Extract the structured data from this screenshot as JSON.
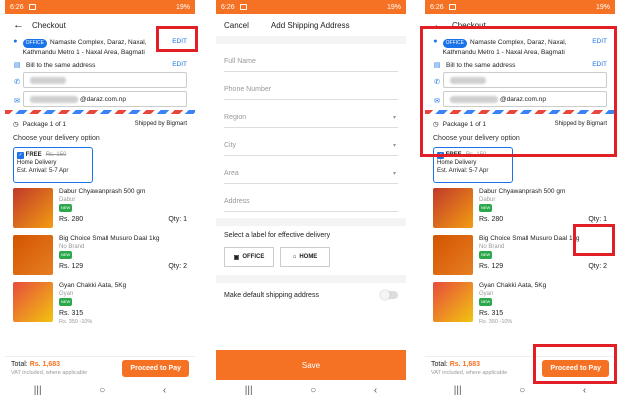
{
  "status": {
    "time": "6:26",
    "battery": "19%"
  },
  "checkout": {
    "title": "Checkout",
    "edit": "EDIT",
    "tag": "OFFICE",
    "address": "Namaste Complex, Daraz, Naxal, Kathmandu Metro 1 - Naxal Area, Bagmati",
    "bill_label": "Bill to the same address",
    "email_suffix": "@daraz.com.np",
    "package": "Package 1 of 1",
    "shipped_by": "Shipped by Bigmart",
    "choose": "Choose your delivery option",
    "delivery": {
      "free": "FREE",
      "old": "Rs. 150",
      "type": "Home Delivery",
      "arrival": "Est. Arrival: 5-7 Apr"
    },
    "items": [
      {
        "name": "Dabur Chyawanprash 500 gm",
        "brand": "Dabur",
        "price": "Rs. 280",
        "old": "",
        "qty": "Qty: 1",
        "color": "#c0392b"
      },
      {
        "name": "Big Choice Small Musuro Daal 1kg",
        "brand": "No Brand",
        "price": "Rs. 129",
        "old": "",
        "qty": "Qty: 2",
        "color": "#d35400"
      },
      {
        "name": "Gyan Chakki Aata, 5Kg",
        "brand": "Gyan",
        "price": "Rs. 315",
        "old": "Rs. 350 -10%",
        "qty": "",
        "color": "#e74c3c"
      }
    ],
    "total_label": "Total:",
    "total_amount": "Rs. 1,683",
    "vat": "VAT included, where applicable",
    "pay": "Proceed to Pay"
  },
  "shipping": {
    "cancel": "Cancel",
    "title": "Add Shipping Address",
    "fields": [
      "Full Name",
      "Phone Number",
      "Region",
      "City",
      "Area",
      "Address"
    ],
    "label_prompt": "Select a label for effective delivery",
    "office": "OFFICE",
    "home": "HOME",
    "default": "Make default shipping address",
    "save": "Save"
  },
  "icons": {
    "back": "back-arrow-icon",
    "location": "location-pin-icon",
    "bill": "bill-icon",
    "phone": "phone-icon",
    "email": "email-icon",
    "package": "package-icon",
    "check": "check-icon"
  },
  "colors": {
    "accent": "#f57224",
    "link": "#1a73e8",
    "highlight": "#e21f26"
  }
}
